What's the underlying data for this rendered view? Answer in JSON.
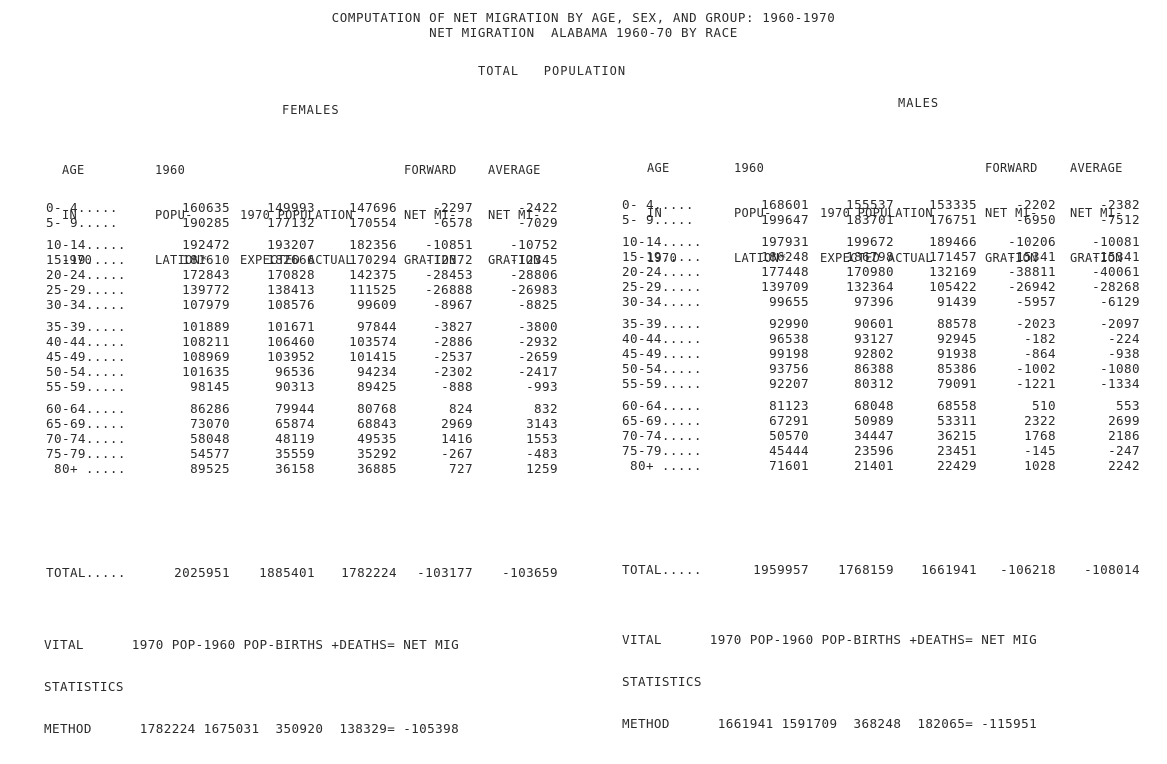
{
  "title_line1": "COMPUTATION OF NET MIGRATION BY AGE, SEX, AND GROUP: 1960-1970",
  "title_line2": "NET MIGRATION  ALABAMA 1960-70 BY RACE",
  "subtitle": "TOTAL   POPULATION",
  "females": {
    "label": "FEMALES",
    "headers": {
      "age": [
        "AGE",
        "IN",
        "1970"
      ],
      "pop1960": [
        "1960",
        "POPU-",
        "LATION*"
      ],
      "pop1970": [
        "",
        "1970 POPULATION",
        "EXPECTED ACTUAL"
      ],
      "forward": [
        "FORWARD",
        "NET MI-",
        "GRATION"
      ],
      "average": [
        "AVERAGE",
        "NET MI-",
        "GRATION"
      ]
    },
    "groups": [
      [
        {
          "age": "0- 4.....",
          "p60": "160635",
          "exp": "149993",
          "act": "147696",
          "fwd": "-2297",
          "avg": "-2422"
        },
        {
          "age": "5- 9.....",
          "p60": "190285",
          "exp": "177132",
          "act": "170554",
          "fwd": "-6578",
          "avg": "-7029"
        }
      ],
      [
        {
          "age": "10-14.....",
          "p60": "192472",
          "exp": "193207",
          "act": "182356",
          "fwd": "-10851",
          "avg": "-10752"
        },
        {
          "age": "15-19.....",
          "p60": "181610",
          "exp": "182666",
          "act": "170294",
          "fwd": "-12372",
          "avg": "-12345"
        },
        {
          "age": "20-24.....",
          "p60": "172843",
          "exp": "170828",
          "act": "142375",
          "fwd": "-28453",
          "avg": "-28806"
        },
        {
          "age": "25-29.....",
          "p60": "139772",
          "exp": "138413",
          "act": "111525",
          "fwd": "-26888",
          "avg": "-26983"
        },
        {
          "age": "30-34.....",
          "p60": "107979",
          "exp": "108576",
          "act": "99609",
          "fwd": "-8967",
          "avg": "-8825"
        }
      ],
      [
        {
          "age": "35-39.....",
          "p60": "101889",
          "exp": "101671",
          "act": "97844",
          "fwd": "-3827",
          "avg": "-3800"
        },
        {
          "age": "40-44.....",
          "p60": "108211",
          "exp": "106460",
          "act": "103574",
          "fwd": "-2886",
          "avg": "-2932"
        },
        {
          "age": "45-49.....",
          "p60": "108969",
          "exp": "103952",
          "act": "101415",
          "fwd": "-2537",
          "avg": "-2659"
        },
        {
          "age": "50-54.....",
          "p60": "101635",
          "exp": "96536",
          "act": "94234",
          "fwd": "-2302",
          "avg": "-2417"
        },
        {
          "age": "55-59.....",
          "p60": "98145",
          "exp": "90313",
          "act": "89425",
          "fwd": "-888",
          "avg": "-993"
        }
      ],
      [
        {
          "age": "60-64.....",
          "p60": "86286",
          "exp": "79944",
          "act": "80768",
          "fwd": "824",
          "avg": "832"
        },
        {
          "age": "65-69.....",
          "p60": "73070",
          "exp": "65874",
          "act": "68843",
          "fwd": "2969",
          "avg": "3143"
        },
        {
          "age": "70-74.....",
          "p60": "58048",
          "exp": "48119",
          "act": "49535",
          "fwd": "1416",
          "avg": "1553"
        },
        {
          "age": "75-79.....",
          "p60": "54577",
          "exp": "35559",
          "act": "35292",
          "fwd": "-267",
          "avg": "-483"
        },
        {
          "age": " 80+ .....",
          "p60": "89525",
          "exp": "36158",
          "act": "36885",
          "fwd": "727",
          "avg": "1259"
        }
      ]
    ],
    "total": {
      "age": "TOTAL.....",
      "p60": "2025951",
      "exp": "1885401",
      "act": "1782224",
      "fwd": "-103177",
      "avg": "-103659"
    },
    "vital": {
      "line1": "VITAL      1970 POP-1960 POP-BIRTHS +DEATHS= NET MIG",
      "line2": "STATISTICS",
      "line3": "METHOD      1782224 1675031  350920  138329= -105398"
    }
  },
  "males": {
    "label": "MALES",
    "headers": {
      "age": [
        "AGE",
        "IN",
        "1970"
      ],
      "pop1960": [
        "1960",
        "POPU-",
        "LATION*"
      ],
      "pop1970": [
        "",
        "1970 POPULATION",
        "EXPECTED ACTUAL"
      ],
      "forward": [
        "FORWARD",
        "NET MI-",
        "GRATION"
      ],
      "average": [
        "AVERAGE",
        "NET MI-",
        "GRATION"
      ]
    },
    "groups": [
      [
        {
          "age": "0- 4.....",
          "p60": "168601",
          "exp": "155537",
          "act": "153335",
          "fwd": "-2202",
          "avg": "-2382"
        },
        {
          "age": "5- 9.....",
          "p60": "199647",
          "exp": "183701",
          "act": "176751",
          "fwd": "-6950",
          "avg": "-7512"
        }
      ],
      [
        {
          "age": "10-14.....",
          "p60": "197931",
          "exp": "199672",
          "act": "189466",
          "fwd": "-10206",
          "avg": "-10081"
        },
        {
          "age": "15-19.....",
          "p60": "186248",
          "exp": "186798",
          "act": "171457",
          "fwd": "-15341",
          "avg": "-15341"
        },
        {
          "age": "20-24.....",
          "p60": "177448",
          "exp": "170980",
          "act": "132169",
          "fwd": "-38811",
          "avg": "-40061"
        },
        {
          "age": "25-29.....",
          "p60": "139709",
          "exp": "132364",
          "act": "105422",
          "fwd": "-26942",
          "avg": "-28268"
        },
        {
          "age": "30-34.....",
          "p60": "99655",
          "exp": "97396",
          "act": "91439",
          "fwd": "-5957",
          "avg": "-6129"
        }
      ],
      [
        {
          "age": "35-39.....",
          "p60": "92990",
          "exp": "90601",
          "act": "88578",
          "fwd": "-2023",
          "avg": "-2097"
        },
        {
          "age": "40-44.....",
          "p60": "96538",
          "exp": "93127",
          "act": "92945",
          "fwd": "-182",
          "avg": "-224"
        },
        {
          "age": "45-49.....",
          "p60": "99198",
          "exp": "92802",
          "act": "91938",
          "fwd": "-864",
          "avg": "-938"
        },
        {
          "age": "50-54.....",
          "p60": "93756",
          "exp": "86388",
          "act": "85386",
          "fwd": "-1002",
          "avg": "-1080"
        },
        {
          "age": "55-59.....",
          "p60": "92207",
          "exp": "80312",
          "act": "79091",
          "fwd": "-1221",
          "avg": "-1334"
        }
      ],
      [
        {
          "age": "60-64.....",
          "p60": "81123",
          "exp": "68048",
          "act": "68558",
          "fwd": "510",
          "avg": "553"
        },
        {
          "age": "65-69.....",
          "p60": "67291",
          "exp": "50989",
          "act": "53311",
          "fwd": "2322",
          "avg": "2699"
        },
        {
          "age": "70-74.....",
          "p60": "50570",
          "exp": "34447",
          "act": "36215",
          "fwd": "1768",
          "avg": "2186"
        },
        {
          "age": "75-79.....",
          "p60": "45444",
          "exp": "23596",
          "act": "23451",
          "fwd": "-145",
          "avg": "-247"
        },
        {
          "age": " 80+ .....",
          "p60": "71601",
          "exp": "21401",
          "act": "22429",
          "fwd": "1028",
          "avg": "2242"
        }
      ]
    ],
    "total": {
      "age": "TOTAL.....",
      "p60": "1959957",
      "exp": "1768159",
      "act": "1661941",
      "fwd": "-106218",
      "avg": "-108014"
    },
    "vital": {
      "line1": "VITAL      1970 POP-1960 POP-BIRTHS +DEATHS= NET MIG",
      "line2": "STATISTICS",
      "line3": "METHOD      1661941 1591709  368248  182065= -115951"
    }
  }
}
